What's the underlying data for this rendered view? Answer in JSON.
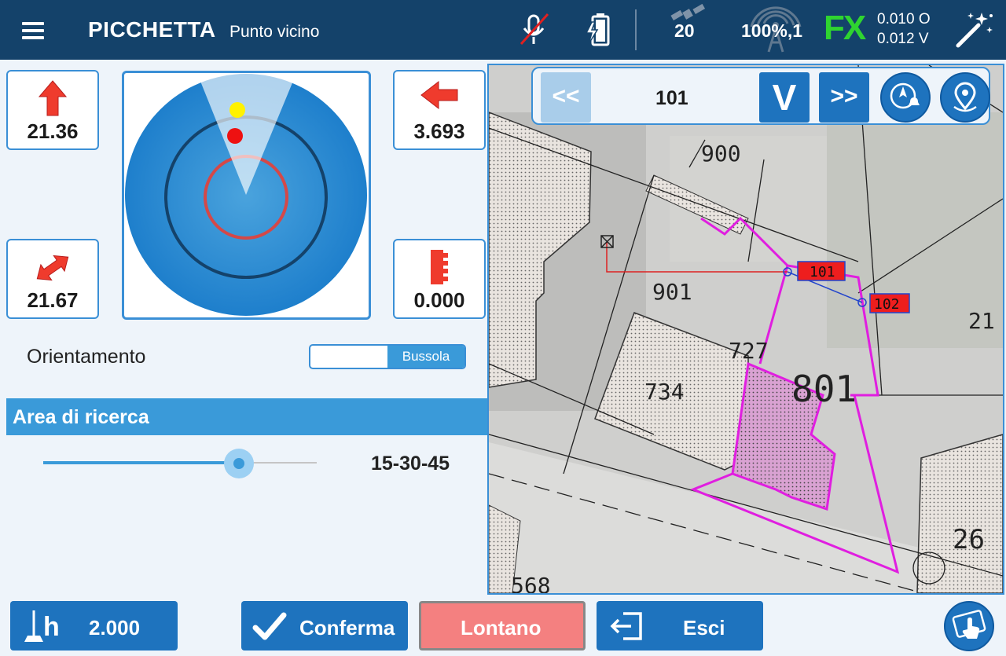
{
  "header": {
    "title": "PICCHETTA",
    "subtitle": "Punto vicino",
    "satellites": "20",
    "battery_level": "100%,1",
    "fix_status": "FX",
    "precision_h": "0.010 O",
    "precision_v": "0.012 V",
    "icons": [
      "menu-icon",
      "mic-off-icon",
      "battery-charging-icon",
      "satellite-icon",
      "antenna-icon",
      "magic-wand-icon"
    ]
  },
  "panels": {
    "north_value": "21.36",
    "east_value": "3.693",
    "distance_value": "21.67",
    "height_value": "0.000"
  },
  "orientation": {
    "label": "Orientamento",
    "toggle_on_label": "Bussola"
  },
  "search_area": {
    "heading": "Area di ricerca",
    "value": "15-30-45",
    "slider_fraction": 0.71
  },
  "map": {
    "prev_label": "<<",
    "next_label": ">>",
    "point_number": "101",
    "v_label": "V",
    "parcel_labels": [
      "900",
      "901",
      "727",
      "734",
      "801",
      "21",
      "26",
      "568"
    ],
    "points": [
      "101",
      "102"
    ]
  },
  "bottom": {
    "antenna_height": "2.000",
    "confirm_label": "Conferma",
    "far_label": "Lontano",
    "exit_label": "Esci"
  },
  "colors": {
    "topbar": "#14426a",
    "accent": "#3a9ad9",
    "button_blue": "#1e73be",
    "far_button": "#f48080",
    "parcel_line": "#e01ee0",
    "fix_green": "#2fd430"
  }
}
